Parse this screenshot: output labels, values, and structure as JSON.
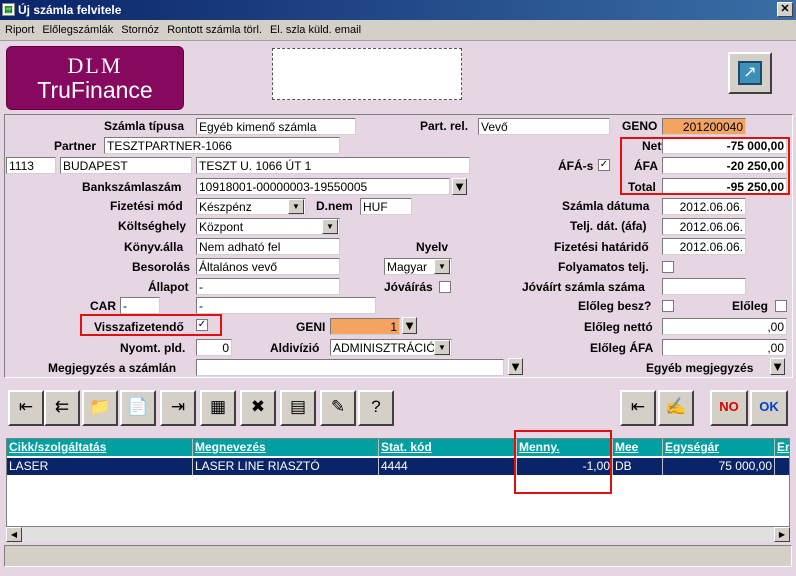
{
  "window": {
    "title": "Új számla felvitele"
  },
  "menu": [
    "Riport",
    "Előlegszámlák",
    "Stornóz",
    "Rontott számla törl.",
    "El. szla küld. email"
  ],
  "logo": {
    "line1": "DLM",
    "line2": "TruFinance"
  },
  "form": {
    "szamla_tipusa": {
      "label": "Számla típusa",
      "value": "Egyéb kimenő számla"
    },
    "part_rel": {
      "label": "Part. rel.",
      "value": "Vevő"
    },
    "geno": {
      "label": "GENO",
      "value": "201200040"
    },
    "partner": {
      "label": "Partner",
      "value": "TESZTPARTNER-1066"
    },
    "zip": "1113",
    "city": "BUDAPEST",
    "address": "TESZT U. 1066 ÚT 1",
    "afas": {
      "label": "ÁFÁ-s",
      "checked": "✓"
    },
    "netto": {
      "label": "Nettó",
      "value": "-75 000,00"
    },
    "afa": {
      "label": "ÁFA",
      "value": "-20 250,00"
    },
    "total": {
      "label": "Total",
      "value": "-95 250,00"
    },
    "bankszamlaszam": {
      "label": "Bankszámlaszám",
      "value": "10918001-00000003-19550005"
    },
    "fizetesi_mod": {
      "label": "Fizetési mód",
      "value": "Készpénz"
    },
    "dnem": {
      "label": "D.nem",
      "value": "HUF"
    },
    "szamla_datuma": {
      "label": "Számla dátuma",
      "value": "2012.06.06."
    },
    "koltseghely": {
      "label": "Költséghely",
      "value": "Központ"
    },
    "telj_dat": {
      "label": "Telj. dát. (áfa)",
      "value": "2012.06.06."
    },
    "konyv_alla": {
      "label": "Könyv.álla",
      "value": "Nem adható fel"
    },
    "nyelv": {
      "label": "Nyelv",
      "value": "Magyar"
    },
    "fizetesi_hatarido": {
      "label": "Fizetési határidő",
      "value": "2012.06.06."
    },
    "besorolas": {
      "label": "Besorolás",
      "value": "Általános vevő"
    },
    "folyamatos_telj": {
      "label": "Folyamatos telj."
    },
    "allapot": {
      "label": "Állapot",
      "value": "-"
    },
    "jovairas": {
      "label": "Jóváírás"
    },
    "jovairt_szamla_szama": {
      "label": "Jóváírt számla száma",
      "value": ""
    },
    "car": {
      "label": "CAR",
      "value1": "-",
      "value2": "-"
    },
    "eloleg_besz": {
      "label": "Előleg besz?"
    },
    "eloleg": {
      "label": "Előleg"
    },
    "visszafizetendo": {
      "label": "Visszafizetendő",
      "checked": "✓"
    },
    "geni": {
      "label": "GENI",
      "value": "1"
    },
    "eloleg_netto": {
      "label": "Előleg nettó",
      "value": ",00"
    },
    "nyomt_pld": {
      "label": "Nyomt. pld.",
      "value": "0"
    },
    "aldivizio": {
      "label": "Aldivízió",
      "value": "ADMINISZTRÁCIÓ"
    },
    "eloleg_afa": {
      "label": "Előleg ÁFA",
      "value": ",00"
    },
    "megjegyzes": {
      "label": "Megjegyzés a számlán",
      "value": ""
    },
    "egyeb_megjegyzes": {
      "label": "Egyéb megjegyzés"
    }
  },
  "toolbar": {
    "ok": "OK",
    "no": "NO"
  },
  "grid": {
    "columns": [
      "Cikk/szolgáltatás",
      "Megnevezés",
      "Stat. kód",
      "Menny.",
      "Mee",
      "Egységár",
      "Em"
    ],
    "rows": [
      [
        "LASER",
        "LASER LINE RIASZTÓ",
        "4444",
        "-1,00",
        "DB",
        "75 000,00",
        ""
      ]
    ]
  },
  "icons": {
    "dropdown": "chevron-down-icon",
    "arrow": "down-arrow-icon",
    "exit": "exit-icon"
  }
}
